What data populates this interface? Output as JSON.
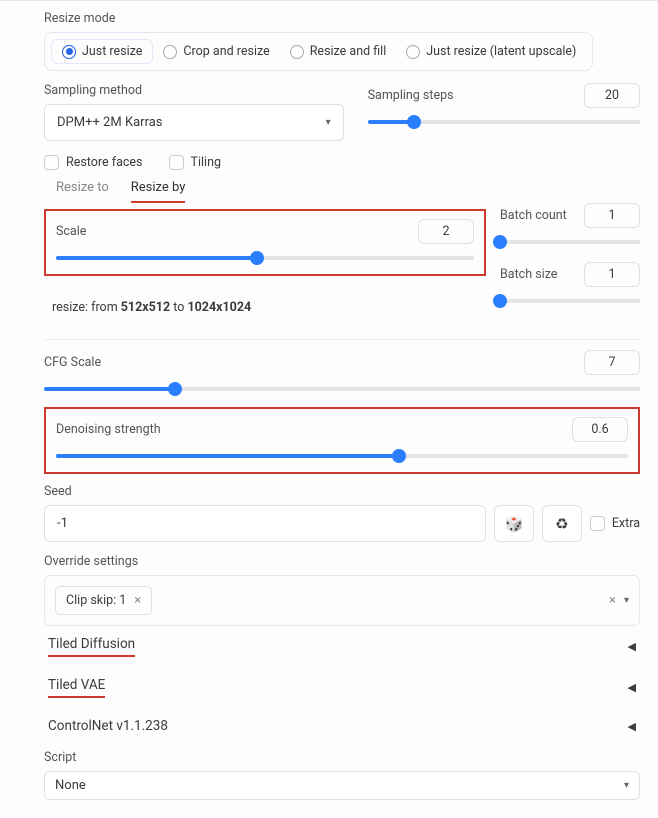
{
  "resize_mode": {
    "label": "Resize mode",
    "options": [
      "Just resize",
      "Crop and resize",
      "Resize and fill",
      "Just resize (latent upscale)"
    ],
    "selected": "Just resize"
  },
  "sampling_method": {
    "label": "Sampling method",
    "value": "DPM++ 2M Karras"
  },
  "sampling_steps": {
    "label": "Sampling steps",
    "value": 20,
    "percent": 17
  },
  "restore_faces": {
    "label": "Restore faces"
  },
  "tiling": {
    "label": "Tiling"
  },
  "tabs": {
    "resize_to": "Resize to",
    "resize_by": "Resize by"
  },
  "scale": {
    "label": "Scale",
    "value": 2,
    "percent": 48
  },
  "resize_info": {
    "prefix": "resize: from ",
    "from": "512x512",
    "mid": " to ",
    "to": "1024x1024"
  },
  "batch_count": {
    "label": "Batch count",
    "value": 1,
    "percent": 0
  },
  "batch_size": {
    "label": "Batch size",
    "value": 1,
    "percent": 0
  },
  "cfg": {
    "label": "CFG Scale",
    "value": 7,
    "percent": 22
  },
  "denoise": {
    "label": "Denoising strength",
    "value": 0.6,
    "percent": 60
  },
  "seed": {
    "label": "Seed",
    "value": "-1",
    "extra_label": "Extra"
  },
  "override": {
    "label": "Override settings",
    "chip_label": "Clip skip: 1"
  },
  "accordions": {
    "tiled_diffusion": "Tiled Diffusion",
    "tiled_vae": "Tiled VAE",
    "controlnet": "ControlNet v1.1.238"
  },
  "script": {
    "label": "Script",
    "value": "None"
  },
  "glyphs": {
    "times": "×",
    "caret_down": "▾",
    "dice": "🎲",
    "recycle": "♻",
    "tri_left": "◀"
  }
}
